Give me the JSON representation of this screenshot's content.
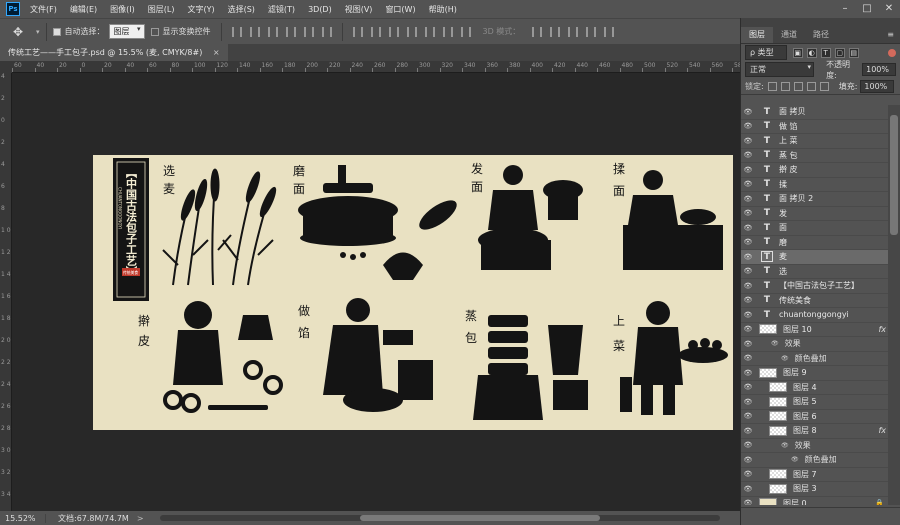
{
  "app": {
    "logo": "Ps"
  },
  "menu": [
    "文件(F)",
    "编辑(E)",
    "图像(I)",
    "图层(L)",
    "文字(Y)",
    "选择(S)",
    "滤镜(T)",
    "3D(D)",
    "视图(V)",
    "窗口(W)",
    "帮助(H)"
  ],
  "window_controls": [
    "–",
    "□",
    "✕"
  ],
  "options": {
    "auto_select_label": "自动选择：",
    "auto_select_value": "图层",
    "show_transform_label": "显示变换控件",
    "mode_3d_label": "3D 模式："
  },
  "document": {
    "tab_title": "传统工艺——手工包子.psd @ 15.5% (麦, CMYK/8#)",
    "close": "×"
  },
  "ruler_top": [
    "60",
    "40",
    "20",
    "0",
    "20",
    "40",
    "60",
    "80",
    "100",
    "120",
    "140",
    "160",
    "180",
    "200",
    "220",
    "240",
    "260",
    "280",
    "300",
    "320",
    "340",
    "360",
    "380",
    "400",
    "420",
    "440",
    "460",
    "480",
    "500",
    "520",
    "540",
    "560",
    "580"
  ],
  "ruler_left": [
    "4",
    "2",
    "0",
    "2",
    "4",
    "6",
    "8",
    "1 0",
    "1 2",
    "1 4",
    "1 6",
    "1 8",
    "2 0",
    "2 2",
    "2 4",
    "2 6",
    "2 8",
    "3 0",
    "3 2",
    "3 4"
  ],
  "status": {
    "zoom": "15.52%",
    "doc_info": "文档:67.8M/74.7M",
    "arrow": ">"
  },
  "panel": {
    "tabs": [
      "图层",
      "通道",
      "路径"
    ],
    "filter_kind": "ρ 类型",
    "blend_mode": "正常",
    "opacity_label": "不透明度:",
    "opacity": "100%",
    "lock_label": "锁定:",
    "fill_label": "填充:",
    "fill": "100%"
  },
  "layers": [
    {
      "type": "text",
      "name": "面 拷贝"
    },
    {
      "type": "text",
      "name": "做 馅"
    },
    {
      "type": "text",
      "name": "上 菜"
    },
    {
      "type": "text",
      "name": "蒸 包"
    },
    {
      "type": "text",
      "name": "擀 皮"
    },
    {
      "type": "text",
      "name": "揉"
    },
    {
      "type": "text",
      "name": "面 拷贝 2"
    },
    {
      "type": "text",
      "name": "发"
    },
    {
      "type": "text",
      "name": "面"
    },
    {
      "type": "text",
      "name": "磨"
    },
    {
      "type": "text",
      "name": "麦",
      "selected": true
    },
    {
      "type": "text",
      "name": "选"
    },
    {
      "type": "text",
      "name": "【中国古法包子工艺】"
    },
    {
      "type": "text",
      "name": "传统美食"
    },
    {
      "type": "text",
      "name": "chuantonggongyi"
    },
    {
      "type": "image",
      "name": "图层 10",
      "fx": "fx"
    },
    {
      "type": "sub",
      "name": "效果",
      "indent": 1
    },
    {
      "type": "sub",
      "name": "颜色叠加",
      "indent": 2
    },
    {
      "type": "image",
      "name": "图层 9"
    },
    {
      "type": "image",
      "name": "图层 4",
      "indent": 1
    },
    {
      "type": "image",
      "name": "图层 5",
      "indent": 1
    },
    {
      "type": "image",
      "name": "图层 6",
      "indent": 1
    },
    {
      "type": "image",
      "name": "图层 8",
      "indent": 1,
      "fx": "fx"
    },
    {
      "type": "sub",
      "name": "效果",
      "indent": 2
    },
    {
      "type": "sub",
      "name": "颜色叠加",
      "indent": 3
    },
    {
      "type": "image",
      "name": "图层 7",
      "indent": 1
    },
    {
      "type": "image",
      "name": "图层 3",
      "indent": 1
    },
    {
      "type": "image",
      "name": "图层 0",
      "solid": true,
      "locked": true
    }
  ],
  "artwork": {
    "title": "【中国古法包子工艺】",
    "pinyin": "CHUANTONGGONGYI",
    "seal": "传统美食",
    "labels": [
      {
        "id": "xuanmai",
        "text": "选\n麦"
      },
      {
        "id": "mo",
        "text": "磨\n面"
      },
      {
        "id": "fa",
        "text": "发\n面"
      },
      {
        "id": "rou",
        "text": "揉\n面"
      },
      {
        "id": "gan",
        "text": "擀\n皮"
      },
      {
        "id": "zuo",
        "text": "做\n馅"
      },
      {
        "id": "zheng",
        "text": "蒸\n包"
      },
      {
        "id": "shang",
        "text": "上\n菜"
      }
    ]
  },
  "colors": {
    "artboard": "#e9e1c2",
    "ink": "#141414",
    "seal": "#c0392b"
  }
}
